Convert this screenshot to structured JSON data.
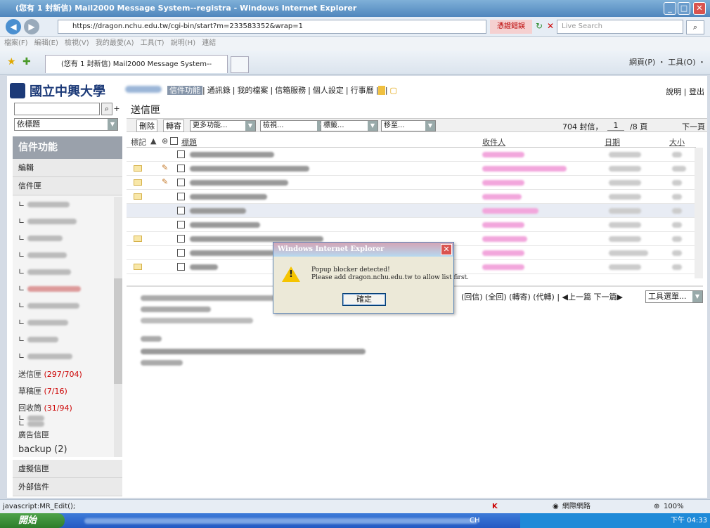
{
  "browser": {
    "title": "(您有 1 封新信) Mail2000 Message System--registra - Windows Internet Explorer",
    "url": "https://dragon.nchu.edu.tw/cgi-bin/start?m=233583352&wrap=1",
    "cert_error": "憑證錯誤",
    "search_placeholder": "Live Search",
    "menu": "檔案(F)  編輯(E)  檢視(V)  我的最愛(A)  工具(T)  說明(H)      連結",
    "tab_label": "(您有 1 封新信) Mail2000 Message System--registra",
    "tools": "網頁(P) ・ 工具(O) ・"
  },
  "app": {
    "logo_text": "國立中興大學",
    "top_tabs": [
      "信件功能",
      "通訊錄",
      "我的檔案",
      "信箱服務",
      "個人設定",
      "行事曆"
    ],
    "help": "說明",
    "logout": "登出",
    "sort_label": "依標題",
    "sidebar_header": "信件功能",
    "sidebar_items": [
      "編輯",
      "信件匣"
    ],
    "folders": {
      "sent": "送信匣",
      "sent_count": "(297/704)",
      "drafts": "草稿匣",
      "drafts_count": "(7/16)",
      "trash": "回收筒",
      "trash_count": "(31/94)",
      "ads": "廣告信匣",
      "backup": "backup",
      "backup_count": "(2)"
    },
    "sidebar_bottom": [
      "虛擬信匣",
      "外部信件"
    ]
  },
  "main": {
    "page_title": "送信匣",
    "toolbar": {
      "delete": "刪除",
      "forward": "轉寄",
      "more": "更多功能...",
      "view": "檢視...",
      "tag": "標籤...",
      "move": "移至...",
      "count": "704 封信，",
      "page": "1",
      "total_pages": "/8 頁",
      "next": "下一頁"
    },
    "columns": {
      "mark": "標記",
      "subject": "標題",
      "recipient": "收件人",
      "date": "日期",
      "size": "大小"
    },
    "preview_bar": "(回信) (全回) (轉寄) (代轉) | ◀上一篇 下一篇▶",
    "tools_menu": "工具選單..."
  },
  "dialog": {
    "title": "Windows Internet Explorer",
    "line1": "Popup blocker detected!",
    "line2": "Please add dragon.nchu.edu.tw to allow list first.",
    "ok": "確定"
  },
  "status": {
    "left": "javascript:MR_Edit();",
    "zone": "網際網路",
    "zoom": "100%"
  },
  "taskbar": {
    "start": "開始",
    "lang": "CH",
    "clock": "下午 04:33"
  }
}
